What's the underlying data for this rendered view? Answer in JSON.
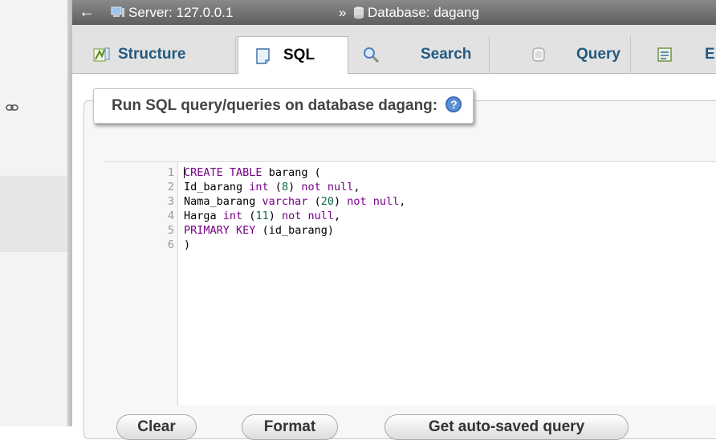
{
  "breadcrumb": {
    "back_icon": "←",
    "server": "Server: 127.0.0.1",
    "separator": "»",
    "database": "Database: dagang"
  },
  "tabs": [
    {
      "label": "Structure",
      "icon": "structure-icon"
    },
    {
      "label": "SQL",
      "icon": "sql-icon",
      "active": true
    },
    {
      "label": "Search",
      "icon": "search-icon"
    },
    {
      "label": "Query",
      "icon": "query-icon"
    },
    {
      "label": "E",
      "icon": "export-icon"
    }
  ],
  "panel": {
    "title": "Run SQL query/queries on database dagang:"
  },
  "editor": {
    "line_numbers": [
      "1",
      "2",
      "3",
      "4",
      "5",
      "6"
    ],
    "lines": [
      "CREATE TABLE barang (",
      "Id_barang int (8) not null,",
      "Nama_barang varchar (20) not null,",
      "Harga int (11) not null,",
      "PRIMARY KEY (id_barang)",
      ")"
    ]
  },
  "buttons": {
    "clear": "Clear",
    "format": "Format",
    "autosaved": "Get auto-saved query"
  },
  "colors": {
    "keyword": "#770088",
    "number": "#116644",
    "tab_text": "#235a81"
  }
}
